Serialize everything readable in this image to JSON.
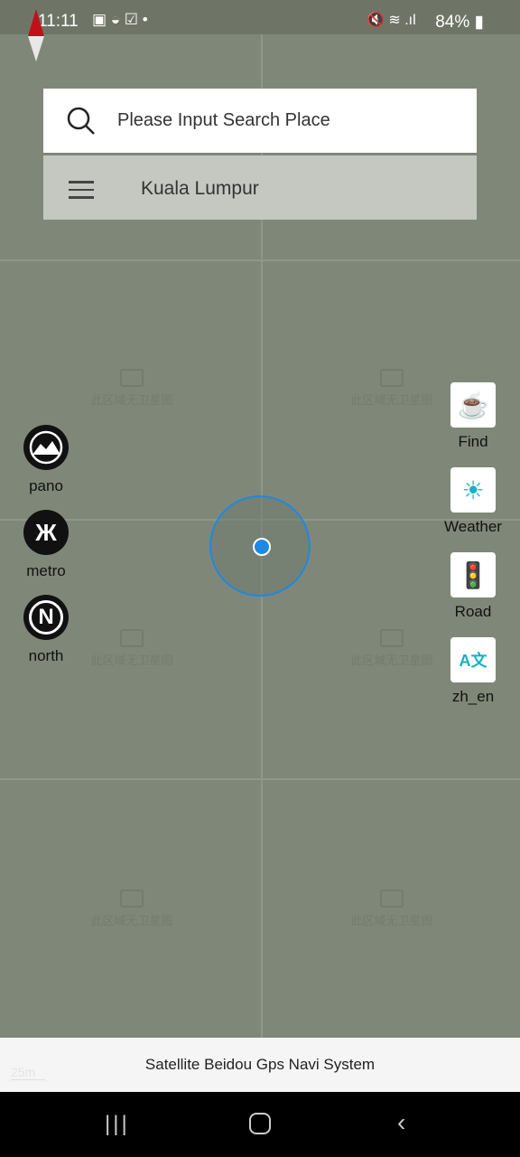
{
  "status_bar": {
    "time": "11:11",
    "battery": "84%",
    "icons": [
      "gallery-icon",
      "cloud-icon",
      "check-icon",
      "dot-icon",
      "mute-icon",
      "wifi-icon",
      "signal-icon",
      "battery-icon"
    ]
  },
  "map": {
    "watermark": "此区域无卫星图",
    "scale": "25m"
  },
  "search": {
    "placeholder": "Please Input Search Place"
  },
  "city": {
    "name": "Kuala Lumpur"
  },
  "left_buttons": [
    {
      "label": "pano",
      "icon": "mountain-icon"
    },
    {
      "label": "metro",
      "icon": "metro-icon",
      "glyph": "Ж"
    },
    {
      "label": "north",
      "icon": "north-icon",
      "glyph": "N"
    }
  ],
  "right_buttons": [
    {
      "label": "Find",
      "icon": "coffee-icon",
      "glyph": "☕"
    },
    {
      "label": "Weather",
      "icon": "sun-icon",
      "glyph": "☀"
    },
    {
      "label": "Road",
      "icon": "traffic-light-icon",
      "glyph": "🚦"
    },
    {
      "label": "zh_en",
      "icon": "translate-icon",
      "glyph": "A文"
    }
  ],
  "footer": {
    "title": "Satellite Beidou Gps Navi System"
  },
  "colors": {
    "accent": "#1e88e5",
    "map_bg": "#7f8878"
  }
}
